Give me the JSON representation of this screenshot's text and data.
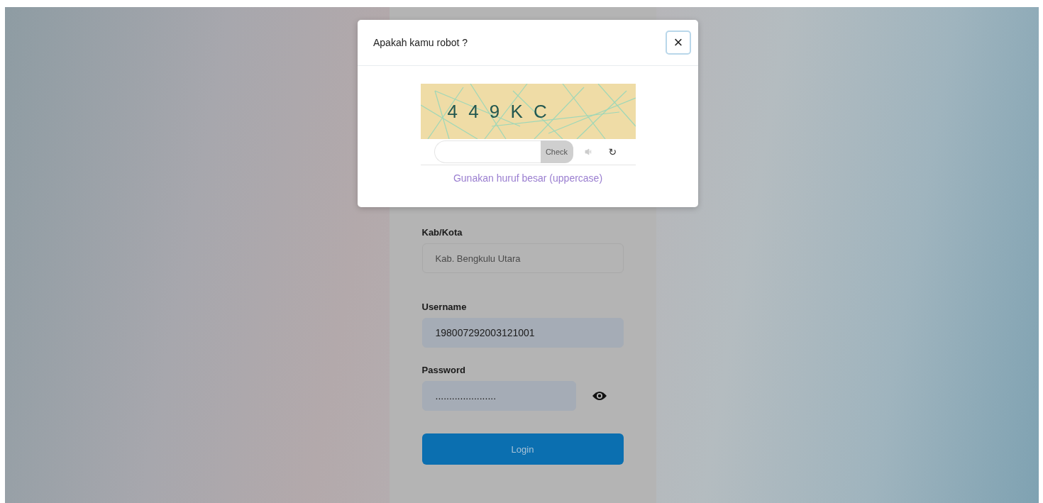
{
  "login_form": {
    "fields": [
      {
        "label": "Kab/Kota",
        "value": "Kab. Bengkulu Utara",
        "kind": "readonly"
      },
      {
        "label": "Username",
        "value": "198007292003121001",
        "kind": "text"
      },
      {
        "label": "Password",
        "value": "......................",
        "kind": "password"
      }
    ],
    "login_button": "Login"
  },
  "captcha_dialog": {
    "title": "Apakah kamu robot ?",
    "close": "×",
    "captcha_text": "4 4 9 K C",
    "check_button": "Check",
    "refresh": "↻",
    "hint": "Gunakan huruf besar (uppercase)"
  }
}
